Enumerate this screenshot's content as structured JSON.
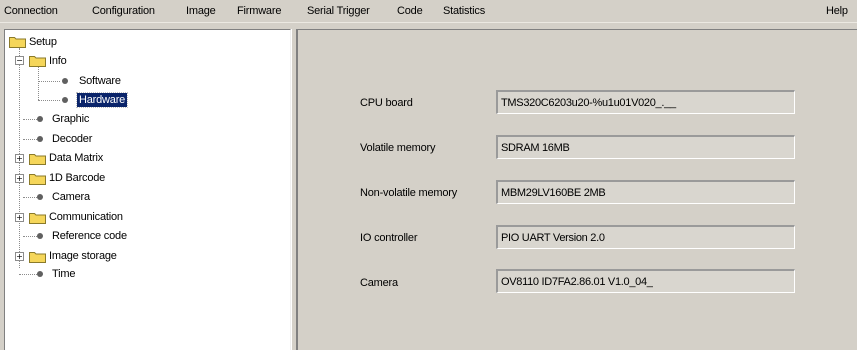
{
  "menubar": {
    "items": [
      "Connection",
      "Configuration",
      "Image",
      "Firmware",
      "Serial Trigger",
      "Code",
      "Statistics"
    ],
    "help": "Help"
  },
  "tree": {
    "root": "Setup",
    "info": "Info",
    "software": "Software",
    "hardware": "Hardware",
    "graphic": "Graphic",
    "decoder": "Decoder",
    "data_matrix": "Data Matrix",
    "barcode_1d": "1D Barcode",
    "camera": "Camera",
    "communication": "Communication",
    "reference_code": "Reference code",
    "image_storage": "Image storage",
    "time": "Time",
    "selected": "Hardware"
  },
  "hardware": {
    "fields": [
      {
        "label": "CPU board",
        "value": "TMS320C6203u20-%u1u01V020_.__"
      },
      {
        "label": "Volatile memory",
        "value": "SDRAM 16MB"
      },
      {
        "label": "Non-volatile memory",
        "value": "MBM29LV160BE  2MB"
      },
      {
        "label": "IO controller",
        "value": "PIO UART Version 2.0"
      },
      {
        "label": "Camera",
        "value": "OV8110 ID7FA2.86.01 V1.0_04_"
      }
    ]
  },
  "colors": {
    "window_bg": "#d4d0c8",
    "selection_bg": "#0a246a",
    "folder": "#f5d65a"
  },
  "icons": {
    "folder": "folder-icon",
    "leaf": "bullet-icon",
    "expand": "plus-icon",
    "collapse": "minus-icon"
  }
}
